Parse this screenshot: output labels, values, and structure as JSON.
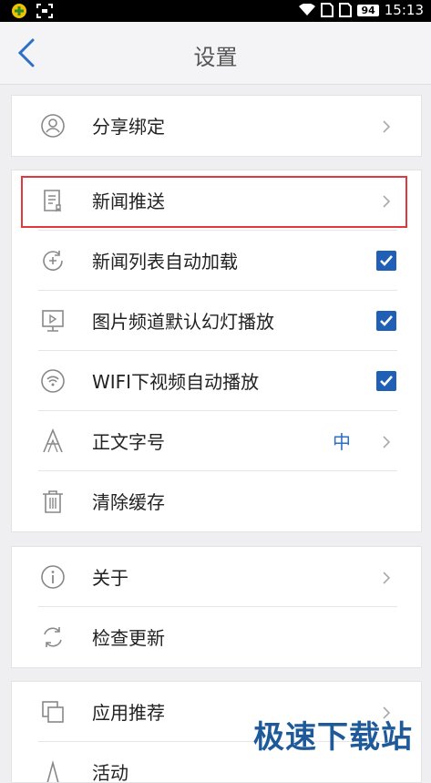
{
  "status_bar": {
    "battery": "94",
    "time": "15:13"
  },
  "header": {
    "title": "设置"
  },
  "sections": [
    {
      "items": [
        {
          "label": "分享绑定",
          "icon": "user-circle-icon"
        }
      ]
    },
    {
      "items": [
        {
          "label": "新闻推送",
          "icon": "news-push-icon"
        },
        {
          "label": "新闻列表自动加载",
          "icon": "refresh-plus-icon",
          "checked": true
        },
        {
          "label": "图片频道默认幻灯播放",
          "icon": "slideshow-icon",
          "checked": true
        },
        {
          "label": "WIFI下视频自动播放",
          "icon": "wifi-icon",
          "checked": true
        },
        {
          "label": "正文字号",
          "icon": "font-size-icon",
          "value": "中"
        },
        {
          "label": "清除缓存",
          "icon": "trash-icon"
        }
      ]
    },
    {
      "items": [
        {
          "label": "关于",
          "icon": "info-icon"
        },
        {
          "label": "检查更新",
          "icon": "sync-icon"
        }
      ]
    },
    {
      "items": [
        {
          "label": "应用推荐",
          "icon": "app-recommend-icon"
        },
        {
          "label": "活动",
          "icon": "activity-icon"
        }
      ]
    }
  ],
  "watermark": "极速下载站",
  "colors": {
    "accent": "#1f5fb5",
    "highlight_border": "#e0393b",
    "value_text": "#2a6fc9"
  }
}
